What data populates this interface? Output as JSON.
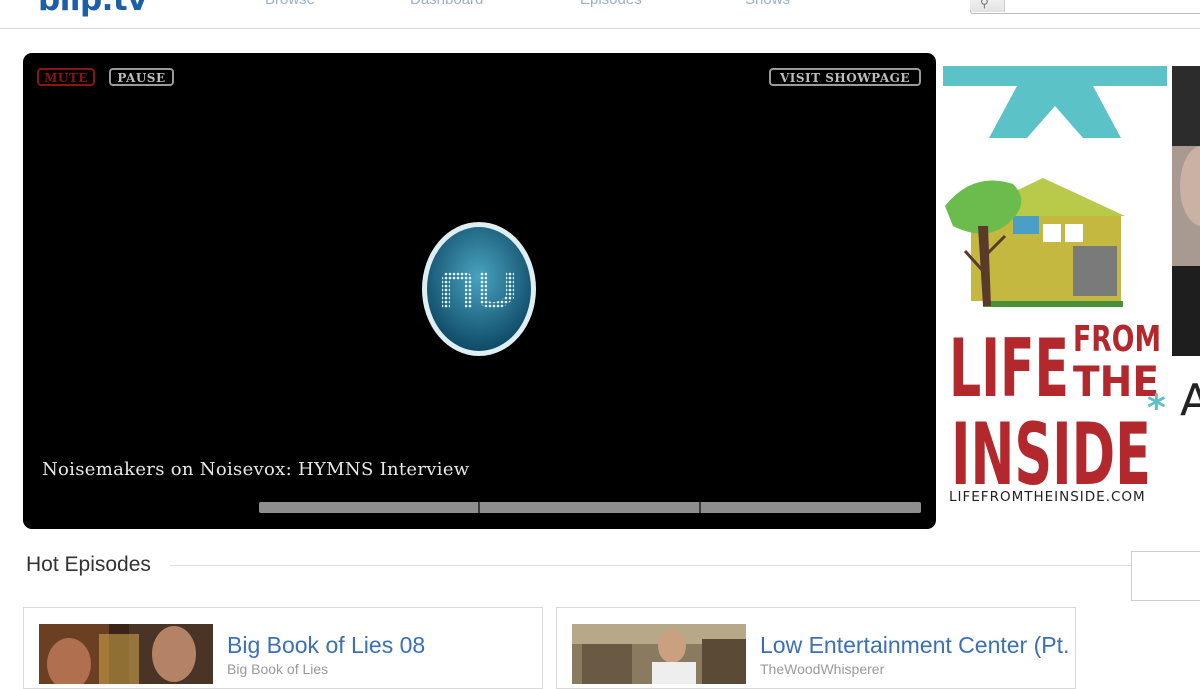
{
  "header": {
    "logo": "blip.tv",
    "nav": [
      "Browse",
      "Dashboard",
      "Episodes",
      "Shows"
    ]
  },
  "player": {
    "mute_label": "MUTE",
    "pause_label": "PAUSE",
    "visit_label": "VISIT SHOWPAGE",
    "title": "Noisemakers on Noisevox: HYMNS Interview",
    "logo_text": "nv"
  },
  "ad": {
    "word1": "LIFE",
    "word2": "FROM",
    "word3": "THE",
    "word4": "INSIDE",
    "url": "LIFEFROMTHEINSIDE.COM",
    "right_glyph": "A"
  },
  "hot_episodes": {
    "title": "Hot Episodes",
    "items": [
      {
        "title": "Big Book of Lies 08",
        "show": "Big Book of Lies"
      },
      {
        "title": "Low Entertainment Center (Pt.",
        "show": "TheWoodWhisperer"
      }
    ]
  },
  "colors": {
    "brand_blue": "#1a5fa8",
    "link_blue": "#3b6fb6",
    "mute_red": "#8a1515",
    "ad_teal": "#5bc3c8",
    "ad_red": "#b3282c"
  }
}
